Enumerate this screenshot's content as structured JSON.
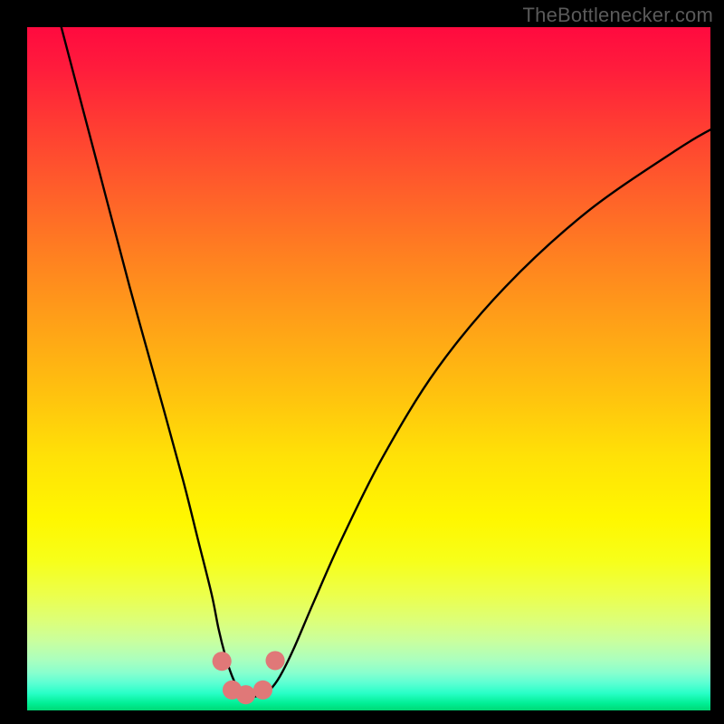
{
  "watermark": "TheBottlenecker.com",
  "chart_data": {
    "type": "line",
    "title": "",
    "xlabel": "",
    "ylabel": "",
    "xlim": [
      0,
      100
    ],
    "ylim": [
      0,
      100
    ],
    "series": [
      {
        "name": "bottleneck-curve",
        "x": [
          5,
          10,
          15,
          20,
          23,
          25,
          27,
          28,
          29,
          30,
          31,
          32,
          33,
          34,
          35.5,
          37,
          39,
          42,
          46,
          52,
          60,
          70,
          82,
          95,
          100
        ],
        "y": [
          100,
          81,
          62,
          44,
          33,
          25,
          17,
          12,
          8,
          5,
          3,
          2.2,
          2,
          2.2,
          3,
          5,
          9,
          16,
          25,
          37,
          50,
          62,
          73,
          82,
          85
        ]
      }
    ],
    "markers": [
      {
        "name": "marker-left",
        "x": 28.5,
        "y": 7.2,
        "r": 1.4
      },
      {
        "name": "marker-bottom-left",
        "x": 30.0,
        "y": 3.0,
        "r": 1.4
      },
      {
        "name": "marker-bottom-mid",
        "x": 32.0,
        "y": 2.3,
        "r": 1.4
      },
      {
        "name": "marker-bottom-right",
        "x": 34.5,
        "y": 3.0,
        "r": 1.4
      },
      {
        "name": "marker-right",
        "x": 36.3,
        "y": 7.3,
        "r": 1.4
      }
    ],
    "marker_color": "#e07878",
    "curve_color": "#000000",
    "background": "gradient-red-yellow-green"
  }
}
